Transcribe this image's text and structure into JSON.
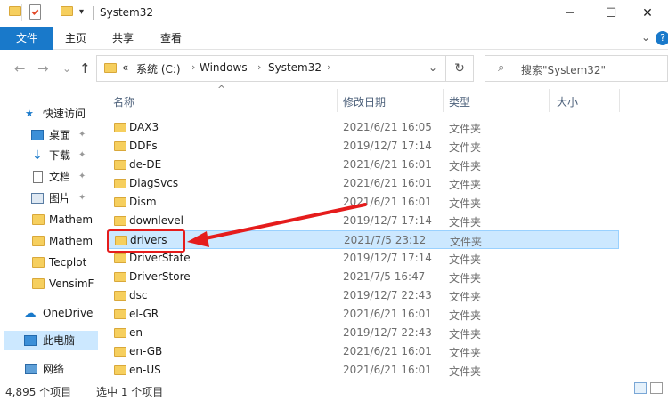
{
  "window": {
    "title": "System32",
    "minimize_label": "─",
    "maximize_label": "☐",
    "close_label": "✕"
  },
  "ribbon": {
    "tabs": [
      "文件",
      "主页",
      "共享",
      "查看"
    ],
    "expand_label": "⌄",
    "help_label": "?"
  },
  "nav": {
    "back": "←",
    "forward": "→",
    "recent": "⌄",
    "up": "↑"
  },
  "address": {
    "overflow": "«",
    "crumbs": [
      "系统 (C:)",
      "Windows",
      "System32"
    ],
    "separator": "›",
    "dropdown": "⌄",
    "refresh": "↻"
  },
  "search": {
    "icon": "⌕",
    "placeholder": "搜索\"System32\""
  },
  "columns": {
    "name": "名称",
    "date": "修改日期",
    "type": "类型",
    "size": "大小",
    "sort_glyph": "^"
  },
  "navpane": {
    "quick_access": "快速访问",
    "items": [
      {
        "label": "桌面",
        "icon": "desktop-icon",
        "pinned": true
      },
      {
        "label": "下载",
        "icon": "download-icon",
        "pinned": true
      },
      {
        "label": "文档",
        "icon": "documents-icon",
        "pinned": true
      },
      {
        "label": "图片",
        "icon": "pictures-icon",
        "pinned": true
      },
      {
        "label": "Mathem",
        "icon": "folder-icon",
        "pinned": false
      },
      {
        "label": "Mathem",
        "icon": "folder-icon",
        "pinned": false
      },
      {
        "label": "Tecplot",
        "icon": "folder-icon",
        "pinned": false
      },
      {
        "label": "VensimF",
        "icon": "folder-icon",
        "pinned": false
      }
    ],
    "onedrive": "OneDrive",
    "this_pc": "此电脑",
    "network": "网络",
    "pin_glyph": "✦"
  },
  "files": [
    {
      "name": "DAX3",
      "date": "2021/6/21 16:05",
      "type": "文件夹"
    },
    {
      "name": "DDFs",
      "date": "2019/12/7 17:14",
      "type": "文件夹"
    },
    {
      "name": "de-DE",
      "date": "2021/6/21 16:01",
      "type": "文件夹"
    },
    {
      "name": "DiagSvcs",
      "date": "2021/6/21 16:01",
      "type": "文件夹"
    },
    {
      "name": "Dism",
      "date": "2021/6/21 16:01",
      "type": "文件夹"
    },
    {
      "name": "downlevel",
      "date": "2019/12/7 17:14",
      "type": "文件夹"
    },
    {
      "name": "drivers",
      "date": "2021/7/5 23:12",
      "type": "文件夹",
      "selected": true
    },
    {
      "name": "DriverState",
      "date": "2019/12/7 17:14",
      "type": "文件夹"
    },
    {
      "name": "DriverStore",
      "date": "2021/7/5 16:47",
      "type": "文件夹"
    },
    {
      "name": "dsc",
      "date": "2019/12/7 22:43",
      "type": "文件夹"
    },
    {
      "name": "el-GR",
      "date": "2021/6/21 16:01",
      "type": "文件夹"
    },
    {
      "name": "en",
      "date": "2019/12/7 22:43",
      "type": "文件夹"
    },
    {
      "name": "en-GB",
      "date": "2021/6/21 16:01",
      "type": "文件夹"
    },
    {
      "name": "en-US",
      "date": "2021/6/21 16:01",
      "type": "文件夹"
    }
  ],
  "status": {
    "item_count": "4,895 个项目",
    "selected": "选中 1 个项目"
  },
  "colors": {
    "accent": "#1979ca",
    "selection": "#cce8ff",
    "annotation": "#e51c1c",
    "folder": "#f6cf5e"
  }
}
